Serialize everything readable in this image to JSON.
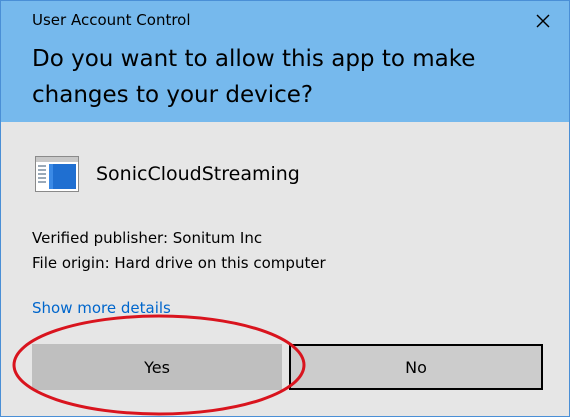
{
  "window": {
    "title": "User Account Control",
    "close_icon": "close-icon"
  },
  "prompt": {
    "question": "Do you want to allow this app to make changes to your device?"
  },
  "app": {
    "name": "SonicCloudStreaming",
    "icon": "app-window-icon"
  },
  "details": {
    "publisher": "Verified publisher: Sonitum Inc",
    "origin": "File origin: Hard drive on this computer",
    "more_link": "Show more details"
  },
  "buttons": {
    "yes_label": "Yes",
    "no_label": "No"
  },
  "colors": {
    "header": "#76b9ed",
    "body": "#e6e6e6",
    "link": "#0066cc",
    "annotation": "#d9141e"
  }
}
